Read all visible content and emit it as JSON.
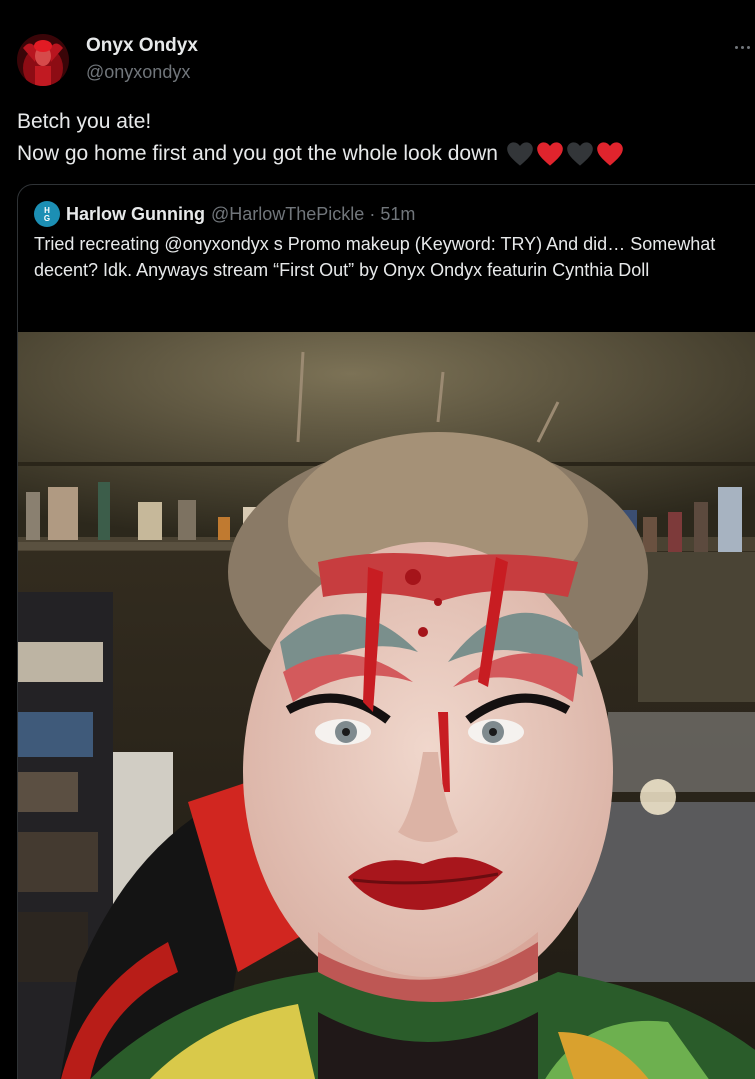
{
  "tweet": {
    "author": {
      "name": "Onyx Ondyx",
      "handle": "@onyxondyx"
    },
    "text_lines": [
      "Betch you ate!",
      "Now go home first and you got the whole look down"
    ],
    "emojis": [
      "black-heart",
      "red-heart",
      "black-heart",
      "red-heart"
    ]
  },
  "quote": {
    "author": {
      "name": "Harlow Gunning",
      "handle": "@HarlowThePickle",
      "separator": "·",
      "time": "51m",
      "avatar_initials": "HG"
    },
    "text": "Tried recreating @onyxondyx s Promo makeup (Keyword: TRY) And did… Somewhat decent? Idk. Anyways stream “First Out” by Onyx Ondyx featurin Cynthia Doll"
  },
  "colors": {
    "background": "#000000",
    "text_primary": "#e7e9ea",
    "text_secondary": "#71767b",
    "border": "#2f3336",
    "red_heart": "#e0242d",
    "black_heart": "#333639"
  }
}
